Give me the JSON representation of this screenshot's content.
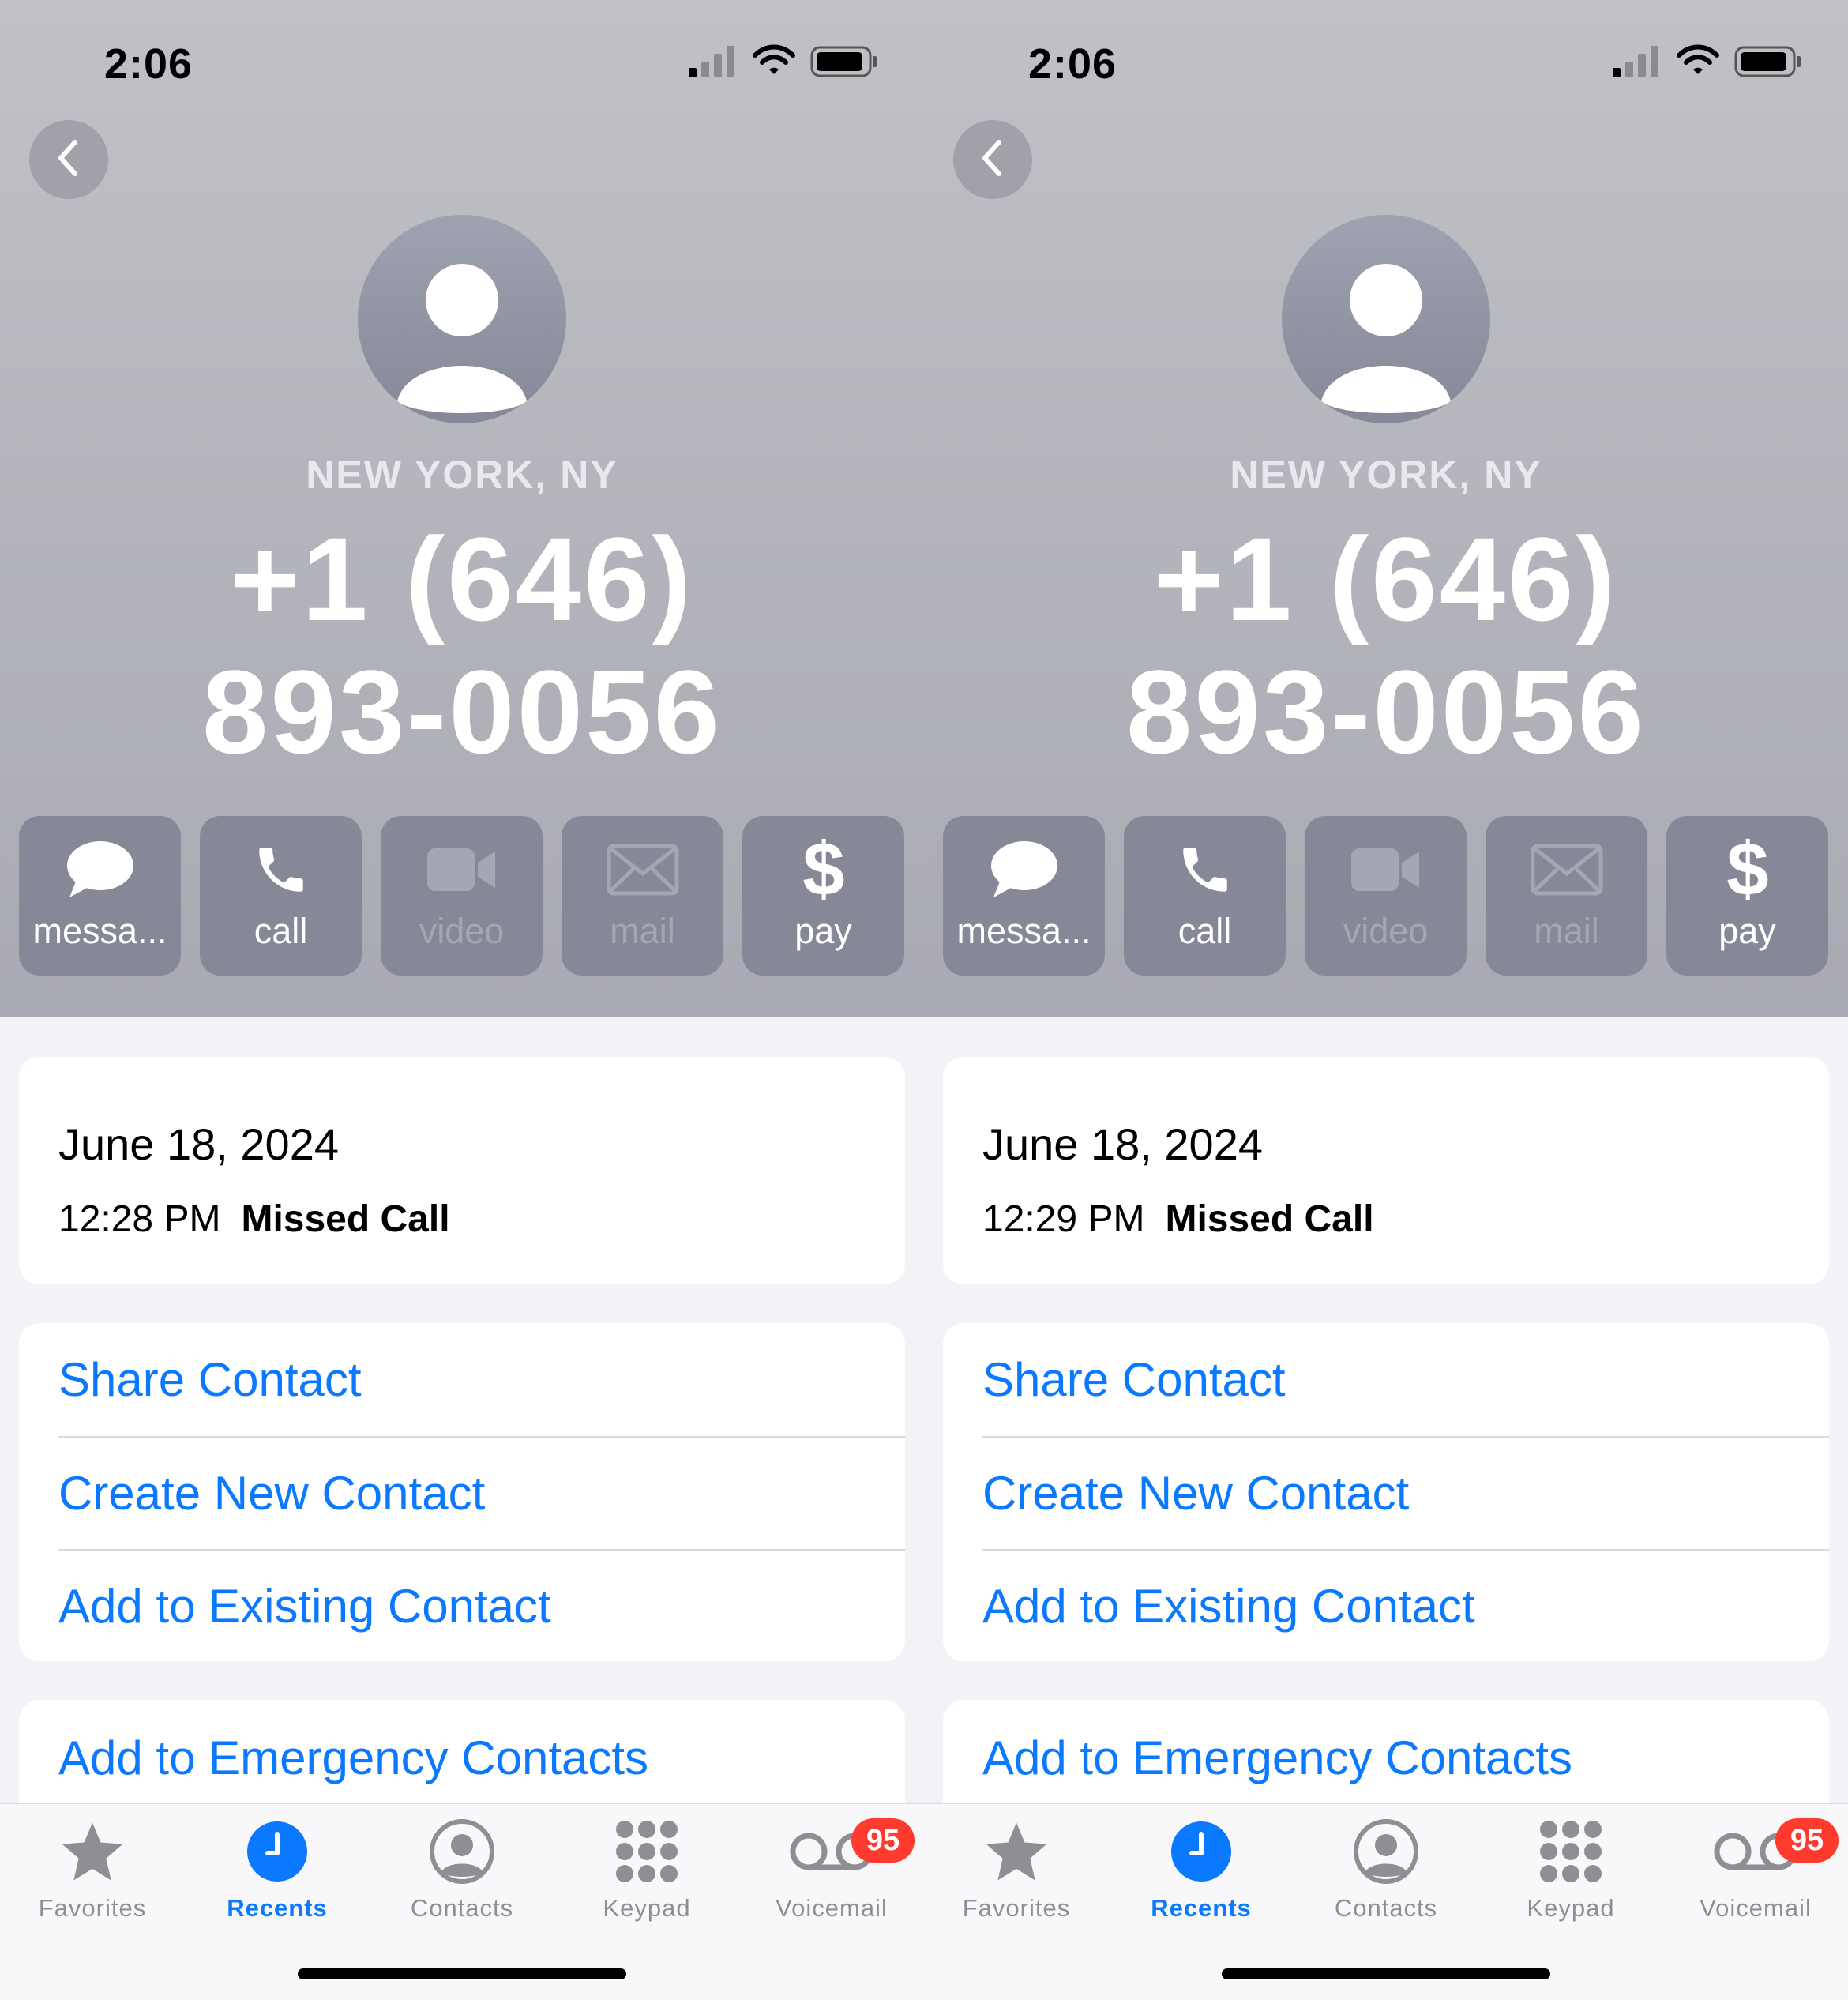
{
  "screens": [
    {
      "status_bar": {
        "time": "2:06"
      },
      "contact": {
        "location": "NEW YORK, NY",
        "phone_line1": "+1 (646)",
        "phone_line2": "893-0056"
      },
      "actions": [
        {
          "label": "messa...",
          "icon": "message-icon",
          "enabled": true
        },
        {
          "label": "call",
          "icon": "phone-icon",
          "enabled": true
        },
        {
          "label": "video",
          "icon": "video-icon",
          "enabled": false
        },
        {
          "label": "mail",
          "icon": "mail-icon",
          "enabled": false
        },
        {
          "label": "pay",
          "icon": "dollar-icon",
          "enabled": true
        }
      ],
      "call_history": {
        "date": "June 18, 2024",
        "time": "12:28 PM",
        "type": "Missed Call"
      },
      "links": [
        "Share Contact",
        "Create New Contact",
        "Add to Existing Contact"
      ],
      "emergency_link": "Add to Emergency Contacts",
      "tabs": [
        {
          "label": "Favorites",
          "icon": "star-icon"
        },
        {
          "label": "Recents",
          "icon": "clock-icon",
          "active": true
        },
        {
          "label": "Contacts",
          "icon": "person-circle-icon"
        },
        {
          "label": "Keypad",
          "icon": "keypad-icon"
        },
        {
          "label": "Voicemail",
          "icon": "voicemail-icon",
          "badge": "95"
        }
      ]
    },
    {
      "status_bar": {
        "time": "2:06"
      },
      "contact": {
        "location": "NEW YORK, NY",
        "phone_line1": "+1 (646)",
        "phone_line2": "893-0056"
      },
      "actions": [
        {
          "label": "messa...",
          "icon": "message-icon",
          "enabled": true
        },
        {
          "label": "call",
          "icon": "phone-icon",
          "enabled": true
        },
        {
          "label": "video",
          "icon": "video-icon",
          "enabled": false
        },
        {
          "label": "mail",
          "icon": "mail-icon",
          "enabled": false
        },
        {
          "label": "pay",
          "icon": "dollar-icon",
          "enabled": true
        }
      ],
      "call_history": {
        "date": "June 18, 2024",
        "time": "12:29 PM",
        "type": "Missed Call"
      },
      "links": [
        "Share Contact",
        "Create New Contact",
        "Add to Existing Contact"
      ],
      "emergency_link": "Add to Emergency Contacts",
      "tabs": [
        {
          "label": "Favorites",
          "icon": "star-icon"
        },
        {
          "label": "Recents",
          "icon": "clock-icon",
          "active": true
        },
        {
          "label": "Contacts",
          "icon": "person-circle-icon"
        },
        {
          "label": "Keypad",
          "icon": "keypad-icon"
        },
        {
          "label": "Voicemail",
          "icon": "voicemail-icon",
          "badge": "95"
        }
      ]
    }
  ],
  "colors": {
    "accent": "#0a78ff",
    "badge": "#ff3b30",
    "header_top": "#c0c1c6",
    "header_bottom": "#a8a9b2",
    "action_bg": "#868897",
    "background": "#f2f2f7"
  }
}
